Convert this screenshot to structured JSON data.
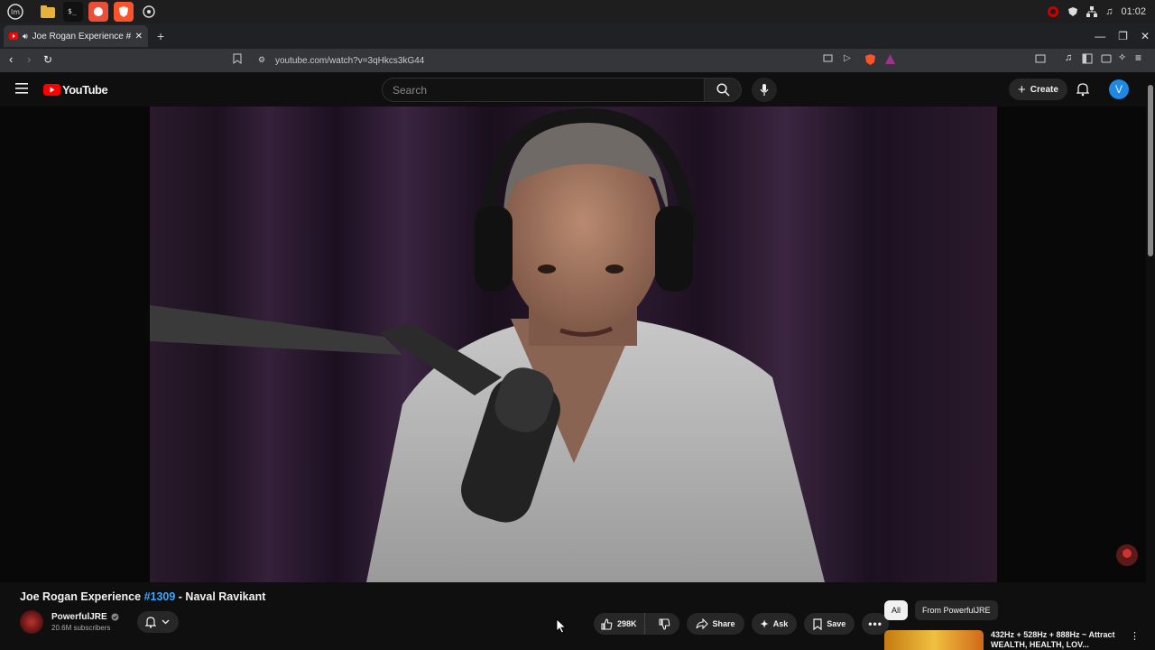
{
  "taskbar": {
    "apps": [
      "mint-menu-icon",
      "files-icon",
      "terminal-icon",
      "firefox-icon",
      "brave-icon",
      "settings-icon"
    ],
    "clock": "01:02"
  },
  "browser": {
    "tab_title": "Joe Rogan Experience #1",
    "url": "youtube.com/watch?v=3qHkcs3kG44",
    "new_tab_label": "+"
  },
  "youtube": {
    "logo_text": "YouTube",
    "search_placeholder": "Search",
    "create_label": "Create",
    "avatar_letter": "V"
  },
  "video": {
    "title_prefix": "Joe Rogan Experience ",
    "title_tag": "#1309",
    "title_suffix": " - Naval Ravikant",
    "channel_name": "PowerfulJRE",
    "subscribers": "20.6M subscribers",
    "likes": "298K",
    "share_label": "Share",
    "ask_label": "Ask",
    "save_label": "Save"
  },
  "sidebar": {
    "chips": [
      "All",
      "From PowerfulJRE"
    ],
    "rec_title": "432Hz + 528Hz + 888Hz ~ Attract WEALTH, HEALTH, LOV..."
  },
  "colors": {
    "accent": "#3ea6ff",
    "youtube_red": "#ff0000",
    "avatar": "#1e88e5"
  }
}
